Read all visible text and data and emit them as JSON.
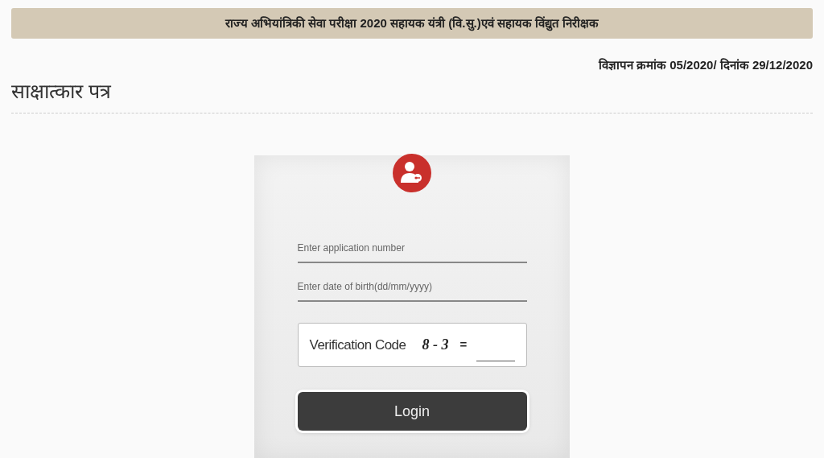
{
  "header": {
    "title": "राज्य अभियांत्रिकी सेवा परीक्षा 2020 सहायक यंत्री (वि.सु.)एवं सहायक विंद्युत निरीक्षक"
  },
  "notice": "विज्ञापन क्रमांक 05/2020/ दिनांक 29/12/2020",
  "page_title": "साक्षात्कार पत्र",
  "form": {
    "fields": [
      {
        "placeholder": "Enter application number"
      },
      {
        "placeholder": "Enter date of birth(dd/mm/yyyy)"
      }
    ],
    "captcha": {
      "label": "Verification Code",
      "expression": "8 - 3",
      "equals": "="
    },
    "button": "Login"
  }
}
